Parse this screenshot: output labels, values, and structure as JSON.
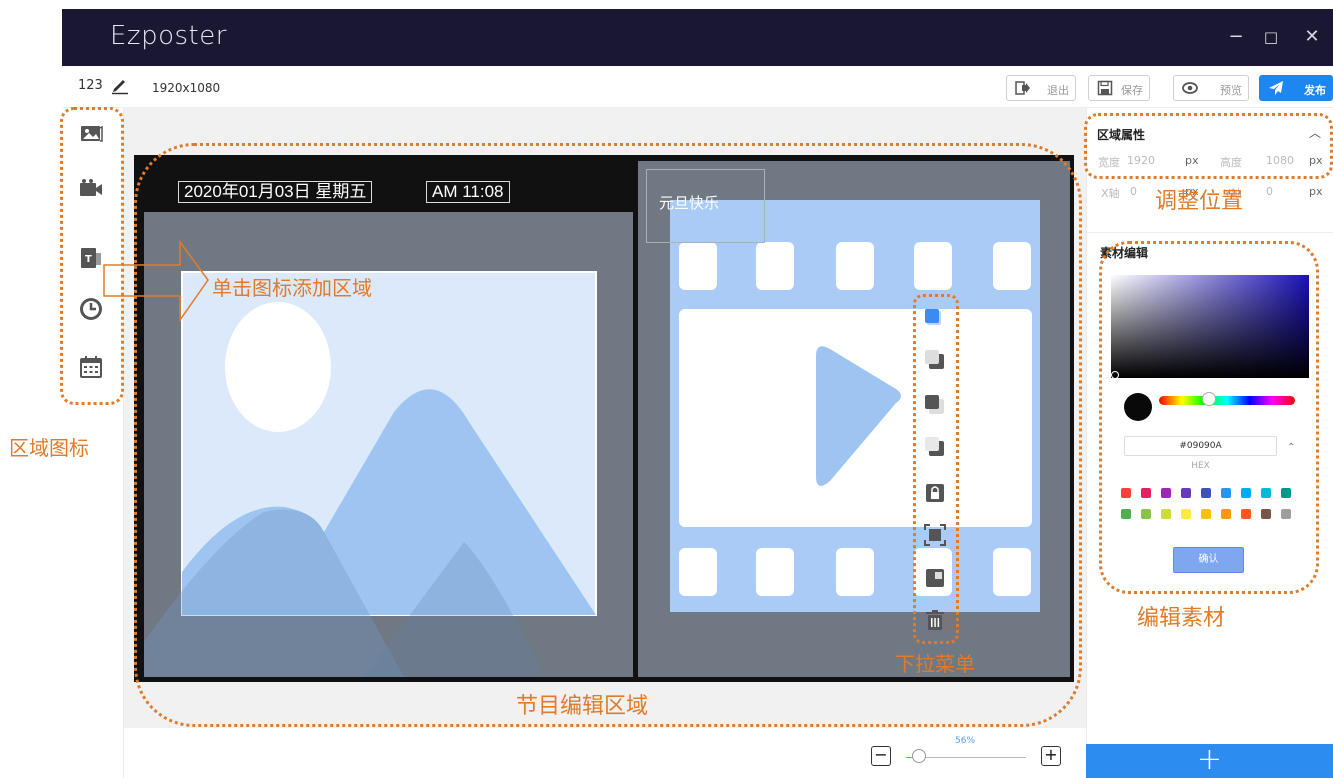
{
  "app": {
    "title": "Ezposter",
    "window_controls": [
      "−",
      "□",
      "✕"
    ]
  },
  "toolbar": {
    "project_name": "123",
    "resolution": "1920x1080",
    "exit_label": "退出",
    "save_label": "保存",
    "preview_label": "预览",
    "publish_label": "发布"
  },
  "sidebar": {
    "icons": [
      "image-icon",
      "video-icon",
      "text-icon",
      "clock-icon",
      "calendar-icon"
    ]
  },
  "canvas": {
    "date_text": "2020年01月03日  星期五",
    "time_text": "AM 11:08",
    "greeting_text": "元旦快乐"
  },
  "layer_menu": {
    "items": [
      "color-fill-icon",
      "bring-forward-icon",
      "send-backward-icon",
      "send-to-back-icon",
      "lock-icon",
      "fullscreen-icon",
      "layer-icon",
      "trash-icon"
    ]
  },
  "right_panel": {
    "region_props_title": "区域属性",
    "width_label": "宽度",
    "width_value": "1920",
    "height_label": "高度",
    "height_value": "1080",
    "x_label": "X轴",
    "x_value": "0",
    "y_label": "Y轴",
    "y_value": "0",
    "unit": "px",
    "material_title": "素材编辑",
    "hex_value": "#09090A",
    "hex_label": "HEX",
    "confirm_label": "确认",
    "add_label": "+",
    "swatches": [
      "#f44336",
      "#e91e63",
      "#9c27b0",
      "#673ab7",
      "#3f51b5",
      "#2196f3",
      "#03a9f4",
      "#00bcd4",
      "#009688",
      "#4caf50",
      "#8bc34a",
      "#cddc39",
      "#ffeb3b",
      "#ffc107",
      "#ff9800",
      "#ff5722",
      "#795548",
      "#9e9e9e"
    ]
  },
  "zoom": {
    "value": "56%",
    "fraction": 0.56,
    "minus": "−",
    "plus": "+"
  },
  "annotations": {
    "region_icons": "区域图标",
    "click_to_add": "单击图标添加区域",
    "adjust_position": "调整位置",
    "edit_material": "编辑素材",
    "dropdown_menu": "下拉菜单",
    "program_edit_area": "节目编辑区域"
  },
  "colors": {
    "accent": "#1e86f0",
    "annotation": "#e07b2a",
    "titlebar": "#1a1733"
  }
}
